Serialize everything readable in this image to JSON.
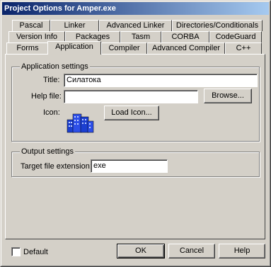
{
  "window": {
    "title": "Project Options for Amper.exe"
  },
  "tabs": {
    "row1": [
      "Pascal",
      "Linker",
      "Advanced Linker",
      "Directories/Conditionals"
    ],
    "row2": [
      "Version Info",
      "Packages",
      "Tasm",
      "CORBA",
      "CodeGuard"
    ],
    "row3": [
      "Forms",
      "Application",
      "Compiler",
      "Advanced Compiler",
      "C++"
    ]
  },
  "app_settings": {
    "group_label": "Application settings",
    "title_label": "Title:",
    "title_value": "Силатока",
    "help_label": "Help file:",
    "help_value": "",
    "browse_label": "Browse...",
    "icon_label": "Icon:",
    "load_icon_label": "Load Icon..."
  },
  "output_settings": {
    "group_label": "Output settings",
    "ext_label": "Target file extension:",
    "ext_value": "exe"
  },
  "footer": {
    "default_label": "Default",
    "ok_label": "OK",
    "cancel_label": "Cancel",
    "help_label": "Help"
  }
}
